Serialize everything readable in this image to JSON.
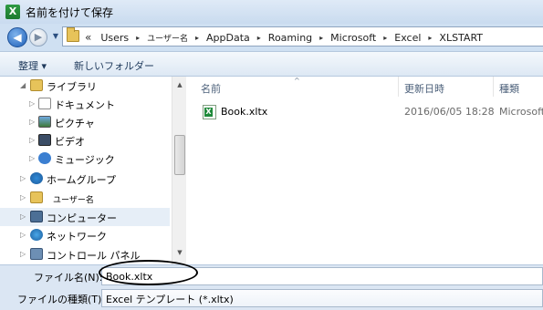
{
  "window": {
    "title": "名前を付けて保存",
    "app_icon_glyph": "X"
  },
  "address": {
    "back_glyph": "◀",
    "forward_glyph": "▶",
    "dropdown_glyph": "▼",
    "overflow_glyph": "«",
    "separator_glyph": "▸",
    "crumbs": [
      "Users",
      "ユーザー名",
      "AppData",
      "Roaming",
      "Microsoft",
      "Excel",
      "XLSTART"
    ]
  },
  "toolbar": {
    "organize_label": "整理 ▾",
    "new_folder_label": "新しいフォルダー"
  },
  "nav": {
    "items": [
      {
        "label": "ライブラリ",
        "expander": "◢",
        "icon": "libraries-icon"
      },
      {
        "label": "ドキュメント",
        "expander": "▷",
        "icon": "documents-icon"
      },
      {
        "label": "ピクチャ",
        "expander": "▷",
        "icon": "pictures-icon"
      },
      {
        "label": "ビデオ",
        "expander": "▷",
        "icon": "videos-icon"
      },
      {
        "label": "ミュージック",
        "expander": "▷",
        "icon": "music-icon"
      },
      {
        "label": "ホームグループ",
        "expander": "▷",
        "icon": "homegroup-icon"
      },
      {
        "label": "ユーザー名",
        "expander": "▷",
        "icon": "user-folder-icon"
      },
      {
        "label": "コンピューター",
        "expander": "▷",
        "icon": "computer-icon"
      },
      {
        "label": "ネットワーク",
        "expander": "▷",
        "icon": "network-icon"
      },
      {
        "label": "コントロール パネル",
        "expander": "▷",
        "icon": "control-panel-icon"
      }
    ],
    "scroll_up_glyph": "▲",
    "scroll_down_glyph": "▼"
  },
  "files": {
    "columns": {
      "name": "名前",
      "modified": "更新日時",
      "type": "種類"
    },
    "sort_glyph": "^",
    "rows": [
      {
        "name": "Book.xltx",
        "modified": "2016/06/05 18:28",
        "type": "Microsoft"
      }
    ]
  },
  "form": {
    "filename_label": "ファイル名(N):",
    "filename_value": "Book.xltx",
    "filetype_label": "ファイルの種類(T):",
    "filetype_value": "Excel テンプレート (*.xltx)"
  },
  "colors": {
    "title_bar": "#c9dbef",
    "toolbar": "#dde8f4",
    "selection": "#e6eef7",
    "excel_green": "#1f8a3a"
  }
}
